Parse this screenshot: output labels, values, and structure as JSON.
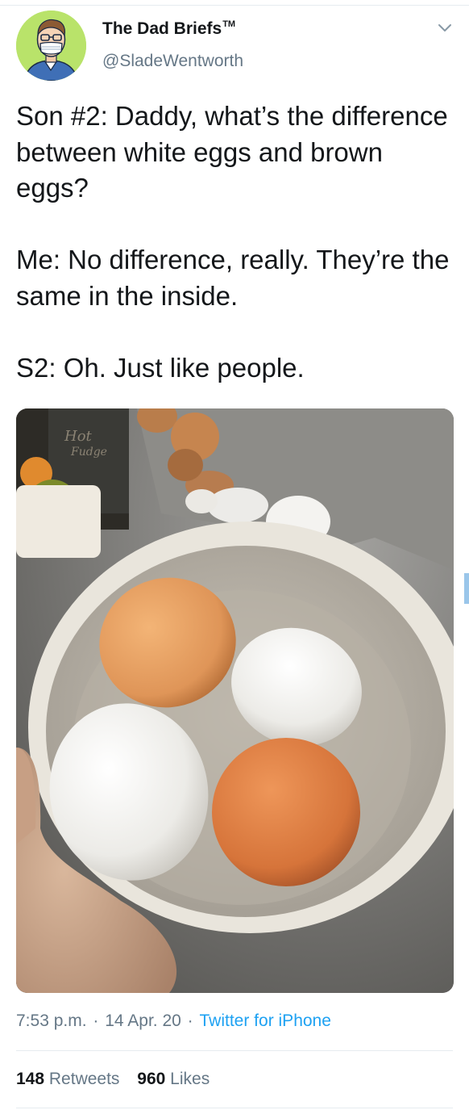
{
  "author": {
    "display_name": "The Dad Briefs",
    "trademark": "TM",
    "handle": "@SladeWentworth",
    "avatar_icon": "cartoon-dad-with-mask-avatar"
  },
  "tweet": {
    "text": "Son #2: Daddy, what’s the difference between white eggs and brown eggs?\n\nMe: No difference, really. They’re the same in the inside.\n\nS2:  Oh. Just like people.",
    "media_description_icon": "photo-bowl-of-eggs"
  },
  "meta": {
    "time": "7:53 p.m.",
    "separator": " · ",
    "date": "14 Apr. 20",
    "source": "Twitter for iPhone"
  },
  "stats": {
    "retweets_count": "148",
    "retweets_label": "Retweets",
    "likes_count": "960",
    "likes_label": "Likes"
  },
  "colors": {
    "text_primary": "#14171a",
    "text_secondary": "#657786",
    "link": "#1da1f2",
    "avatar_bg": "#b9e36a"
  }
}
